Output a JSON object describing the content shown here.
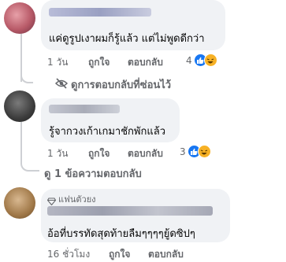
{
  "comments": [
    {
      "text": "แค่ดูรูปเงาผมก็รู้แล้ว แต่ไม่พูดดีกว่า",
      "time": "1 วัน",
      "like_label": "ถูกใจ",
      "reply_label": "ตอบกลับ",
      "reaction_count": "4"
    },
    {
      "text": "รู้จากวงเก้าเกมาชักพักแล้ว",
      "time": "1 วัน",
      "like_label": "ถูกใจ",
      "reply_label": "ตอบกลับ",
      "reaction_count": "3"
    },
    {
      "badge": "แฟนตัวยง",
      "text": "อ้อที่บรรทัดสุดท้ายลืมๆๆๆๆยู้ดซิปๆ",
      "time": "16 ชั่วโมง",
      "like_label": "ถูกใจ",
      "reply_label": "ตอบกลับ"
    }
  ],
  "hidden_replies_link": "ดูการตอบกลับที่ซ่อนไว้",
  "view_replies_link": "ดู 1 ข้อความตอบกลับ",
  "colors": {
    "bubble": "#f0f2f5",
    "meta_text": "#65676b",
    "like_blue": "#1877f2",
    "haha_yellow": "#f7b125"
  },
  "icons": [
    "eye-slash-icon",
    "like-reaction-icon",
    "haha-reaction-icon",
    "diamond-icon"
  ]
}
